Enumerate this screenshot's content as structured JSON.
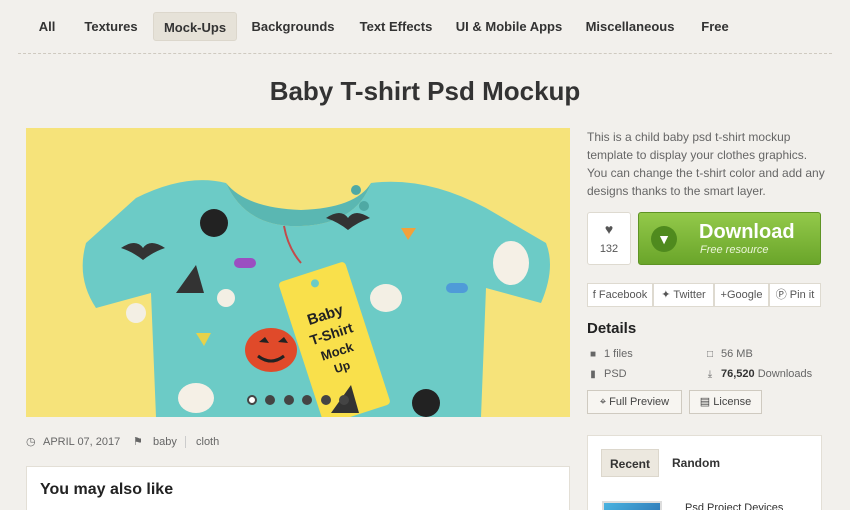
{
  "nav": {
    "items": [
      {
        "label": "All",
        "active": false
      },
      {
        "label": "Textures",
        "active": false
      },
      {
        "label": "Mock-Ups",
        "active": true
      },
      {
        "label": "Backgrounds",
        "active": false
      },
      {
        "label": "Text Effects",
        "active": false
      },
      {
        "label": "UI & Mobile Apps",
        "active": false
      },
      {
        "label": "Miscellaneous",
        "active": false
      },
      {
        "label": "Free",
        "active": false
      }
    ]
  },
  "page": {
    "title": "Baby T-shirt Psd Mockup",
    "description": "This is a child baby psd t-shirt mockup template to display your clothes graphics. You can change the t-shirt color and add any designs thanks to the smart layer."
  },
  "image": {
    "tag_text": "Baby T-Shirt Mock Up",
    "slides": 6,
    "active_slide": 1
  },
  "meta": {
    "date": "APRIL 07, 2017",
    "tags": [
      "baby",
      "cloth"
    ]
  },
  "likes": {
    "count": "132"
  },
  "download": {
    "label": "Download",
    "sublabel": "Free resource"
  },
  "share": {
    "facebook": "Facebook",
    "twitter": "Twitter",
    "google": "+Google",
    "pinterest": "Pin it"
  },
  "details": {
    "title": "Details",
    "files": "1 files",
    "size": "56 MB",
    "format": "PSD",
    "downloads_count": "76,520",
    "downloads_label": "Downloads",
    "full_preview": "Full Preview",
    "license": "License"
  },
  "related": {
    "title": "You may also like"
  },
  "sidebar_panel": {
    "tabs": [
      {
        "label": "Recent",
        "active": true
      },
      {
        "label": "Random",
        "active": false
      }
    ],
    "first_item": "Psd Project Devices"
  },
  "colors": {
    "accent_green": "#7ab537",
    "background": "#f2f0ec",
    "shirt": "#6ccbc6",
    "image_bg": "#f6e37a"
  }
}
